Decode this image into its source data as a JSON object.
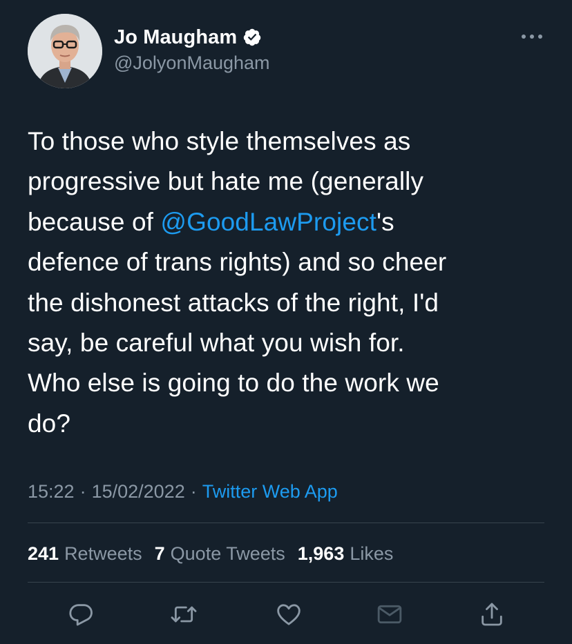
{
  "author": {
    "display_name": "Jo Maugham",
    "handle": "@JolyonMaugham",
    "verified": true
  },
  "tweet": {
    "text_before_mention": "To those who style themselves as\nprogressive but hate me (generally\nbecause of ",
    "mention": "@GoodLawProject",
    "text_after_mention": "'s\ndefence of trans rights) and so cheer\nthe dishonest attacks of the right, I'd\nsay, be careful what you wish for.\nWho else is going to do the work we\ndo?"
  },
  "meta": {
    "time": "15:22",
    "separator": "·",
    "date": "15/02/2022",
    "source": "Twitter Web App"
  },
  "stats": {
    "retweets_count": "241",
    "retweets_label": "Retweets",
    "quotes_count": "7",
    "quotes_label": "Quote Tweets",
    "likes_count": "1,963",
    "likes_label": "Likes"
  },
  "colors": {
    "background": "#15202b",
    "accent": "#1d9bf0",
    "secondary_text": "#8b98a5",
    "divider": "#38444d"
  },
  "icons": {
    "more": "more-horizontal-icon",
    "reply": "reply-icon",
    "retweet": "retweet-icon",
    "like": "heart-icon",
    "dm": "envelope-icon",
    "share": "share-icon"
  }
}
